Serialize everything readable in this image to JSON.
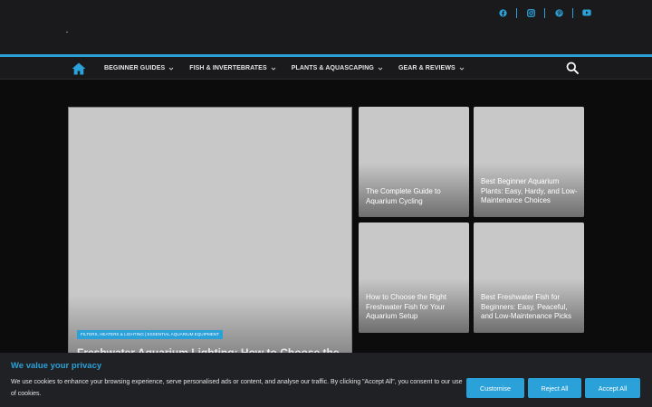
{
  "header": {
    "social_icons": [
      "facebook-icon",
      "instagram-icon",
      "pinterest-icon",
      "youtube-icon"
    ]
  },
  "nav": {
    "items": [
      {
        "label": "BEGINNER GUIDES"
      },
      {
        "label": "FISH & INVERTEBRATES"
      },
      {
        "label": "PLANTS & AQUASCAPING"
      },
      {
        "label": "GEAR & REVIEWS"
      }
    ]
  },
  "hero": {
    "categories": "FILTERS, HEATERS & LIGHTING | ESSENTIAL AQUARIUM EQUIPMENT",
    "title": "Freshwater Aquarium Lighting: How to Choose the"
  },
  "cards": [
    {
      "title": "The Complete Guide to Aquarium Cycling"
    },
    {
      "title": "Best Beginner Aquarium Plants: Easy, Hardy, and Low-Maintenance Choices"
    },
    {
      "title": "How to Choose the Right Freshwater Fish for Your Aquarium Setup"
    },
    {
      "title": "Best Freshwater Fish for Beginners: Easy, Peaceful, and Low-Maintenance Picks"
    }
  ],
  "cookie": {
    "title": "We value your privacy",
    "text": "We use cookies to enhance your browsing experience, serve personalised ads or content, and analyse our traffic. By clicking \"Accept All\", you consent to our use of cookies.",
    "customise_label": "Customise",
    "reject_label": "Reject All",
    "accept_label": "Accept All"
  },
  "colors": {
    "accent": "#2aa1d8",
    "background": "#0c0c0c",
    "bar": "#1a1a1c"
  }
}
